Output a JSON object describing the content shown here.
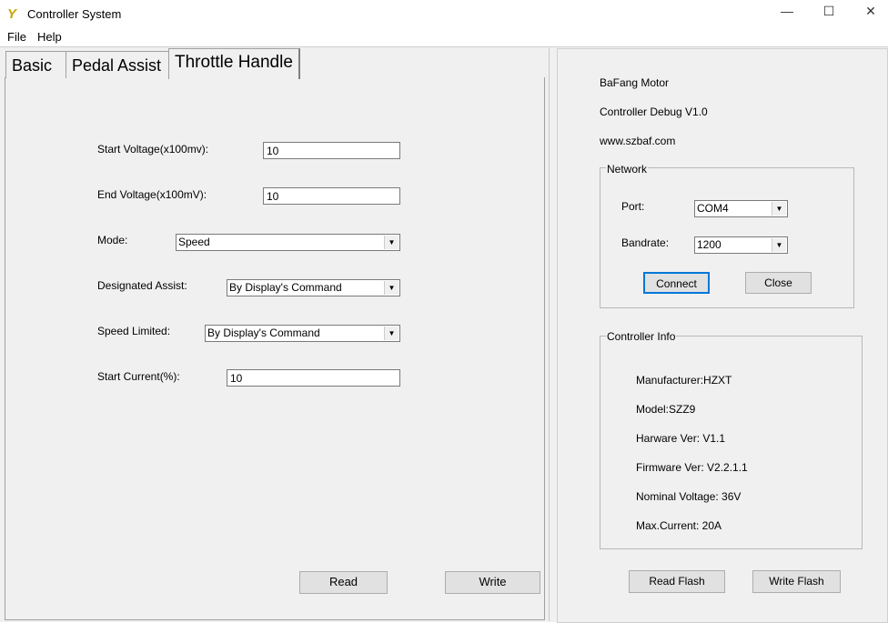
{
  "window": {
    "title": "Controller System",
    "minimize": "—",
    "maximize": "☐",
    "close": "✕"
  },
  "menu": {
    "file": "File",
    "help": "Help"
  },
  "tabs": [
    "Basic",
    "Pedal Assist",
    "Throttle Handle"
  ],
  "form": {
    "start_voltage": {
      "label": "Start Voltage(x100mv):",
      "value": "10"
    },
    "end_voltage": {
      "label": "End Voltage(x100mV):",
      "value": "10"
    },
    "mode": {
      "label": "Mode:",
      "value": "Speed"
    },
    "designated_assist": {
      "label": "Designated Assist:",
      "value": "By Display's Command"
    },
    "speed_limited": {
      "label": "Speed Limited:",
      "value": "By Display's Command"
    },
    "start_current": {
      "label": "Start Current(%):",
      "value": "10"
    },
    "read": "Read",
    "write": "Write"
  },
  "about": {
    "line1": "BaFang Motor",
    "line2": "Controller Debug V1.0",
    "line3": "www.szbaf.com"
  },
  "network": {
    "title": "Network",
    "port_label": "Port:",
    "port": "COM4",
    "baud_label": "Bandrate:",
    "baud": "1200",
    "connect": "Connect",
    "close": "Close"
  },
  "info": {
    "title": "Controller Info",
    "manufacturer": "Manufacturer:HZXT",
    "model": "Model:SZZ9",
    "hw": "Harware Ver: V1.1",
    "fw": "Firmware Ver: V2.2.1.1",
    "voltage": "Nominal Voltage: 36V",
    "current": "Max.Current: 20A"
  },
  "flash": {
    "read": "Read Flash",
    "write": "Write Flash"
  }
}
